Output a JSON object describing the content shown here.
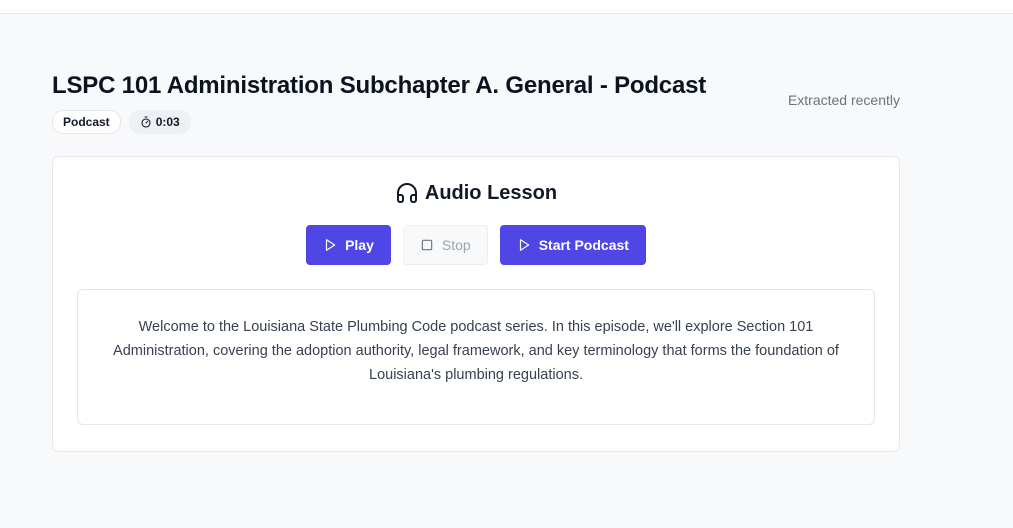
{
  "header": {
    "title": "LSPC 101 Administration Subchapter A. General - Podcast",
    "extracted_label": "Extracted recently",
    "type_badge": "Podcast",
    "duration_icon": "timer-icon",
    "duration": "0:03"
  },
  "lesson": {
    "icon": "headphones-icon",
    "title": "Audio Lesson",
    "buttons": {
      "play_label": "Play",
      "stop_label": "Stop",
      "start_podcast_label": "Start Podcast"
    },
    "transcript": "Welcome to the Louisiana State Plumbing Code podcast series. In this episode, we'll explore Section 101 Administration, covering the adoption authority, legal framework, and key terminology that forms the foundation of Louisiana's plumbing regulations."
  },
  "colors": {
    "accent": "#4f46e5",
    "page_background": "#f8f9fb",
    "card_background": "#ffffff",
    "muted_text": "#6b7280"
  }
}
